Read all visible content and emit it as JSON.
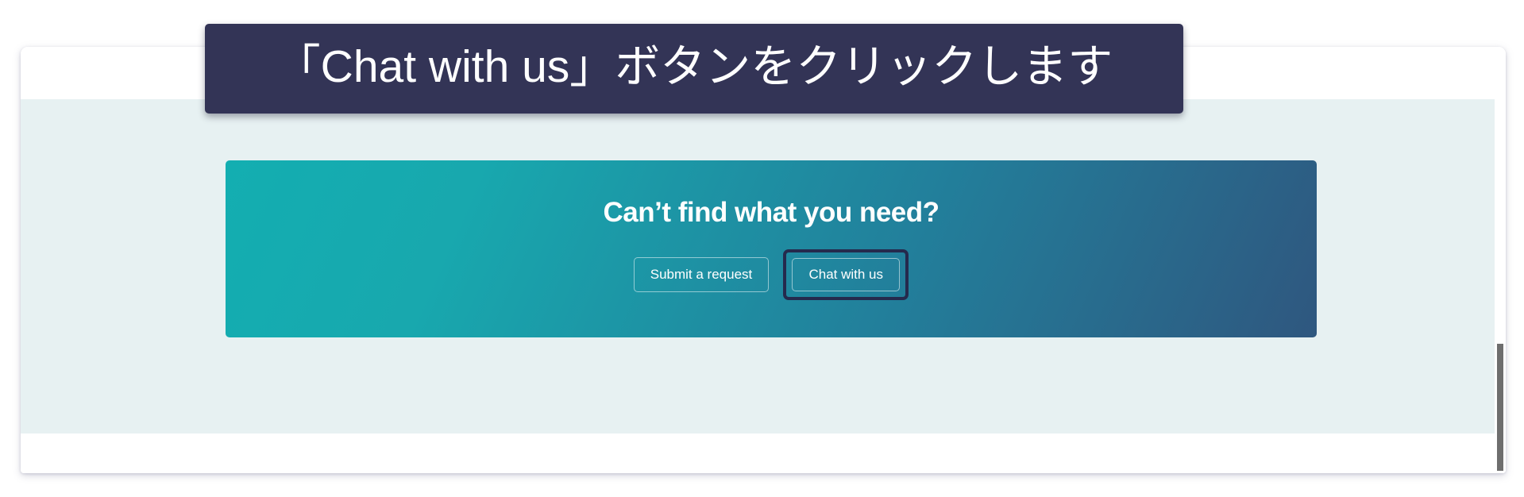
{
  "instruction_banner": {
    "text": "「Chat with us」ボタンをクリックします",
    "background_color": "#333456",
    "text_color": "#ffffff"
  },
  "page": {
    "frame_background": "#ffffff",
    "body_background": "#e7f1f2"
  },
  "help_card": {
    "title": "Can’t find what you need?",
    "gradient_start_color": "#13aeb1",
    "gradient_end_color": "#2f577f",
    "buttons": [
      {
        "label": "Submit a request",
        "name": "submit-a-request-button",
        "highlighted": false
      },
      {
        "label": "Chat with us",
        "name": "chat-with-us-button",
        "highlighted": true,
        "highlight_color": "#252a4d"
      }
    ]
  },
  "scrollbar": {
    "thumb_color": "#6e6e6e"
  }
}
